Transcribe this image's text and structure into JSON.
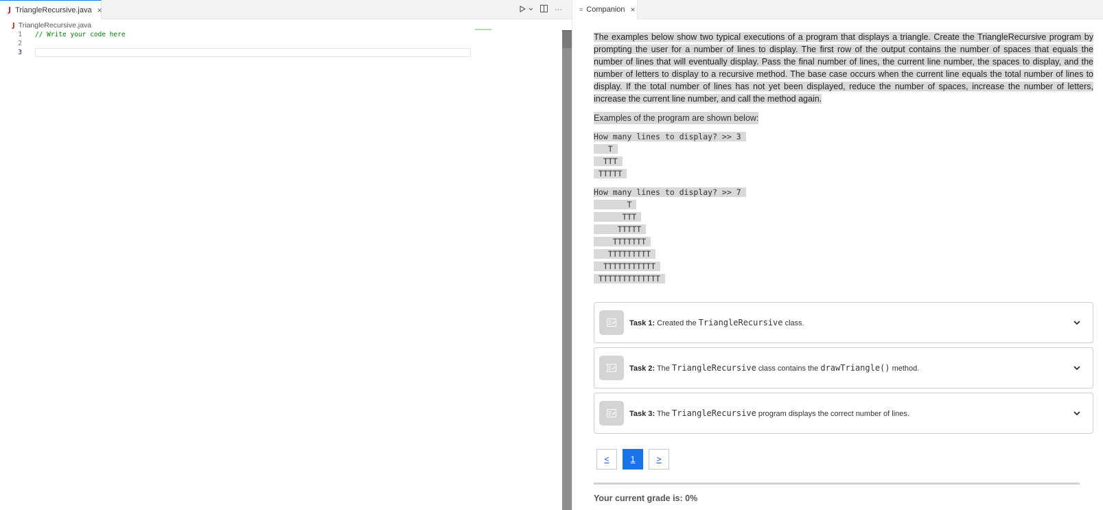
{
  "editor": {
    "tab_label": "TriangleRecursive.java",
    "breadcrumb": "TriangleRecursive.java",
    "line_numbers": [
      "1",
      "2",
      "3"
    ],
    "code_lines": [
      "// Write your code here",
      "",
      ""
    ]
  },
  "companion": {
    "tab_label": "Companion",
    "intro": "The examples below show two typical executions of a program that displays a triangle. Create the TriangleRecursive program by prompting the user for a number of lines to display. The first row of the output contains the number of spaces that equals the number of lines that will eventually display. Pass the final number of lines, the current line number, the spaces to display, and the number of letters to display to a recursive method. The base case occurs when the current line equals the total number of lines to display. If the total number of lines has not yet been displayed, reduce the number of spaces, increase the number of letters, increase the current line number, and call the method again.",
    "examples_label": "Examples of the program are shown below:",
    "example1": [
      "How many lines to display? >> 3 ",
      "   T ",
      "  TTT ",
      " TTTTT "
    ],
    "example2": [
      "How many lines to display? >> 7 ",
      "       T ",
      "      TTT ",
      "     TTTTT ",
      "    TTTTTTT ",
      "   TTTTTTTTT ",
      "  TTTTTTTTTTT ",
      " TTTTTTTTTTTTT "
    ],
    "tasks": [
      {
        "label": "Task 1:",
        "pre": " Created the ",
        "code": "TriangleRecursive",
        "post": " class."
      },
      {
        "label": "Task 2:",
        "pre": " The ",
        "code": "TriangleRecursive",
        "mid": " class contains the ",
        "code2": "drawTriangle()",
        "post": " method."
      },
      {
        "label": "Task 3:",
        "pre": " The ",
        "code": "TriangleRecursive",
        "post": " program displays the correct number of lines."
      }
    ],
    "pager": {
      "prev": "<",
      "current": "1",
      "next": ">"
    },
    "grade": "Your current grade is: 0%"
  }
}
